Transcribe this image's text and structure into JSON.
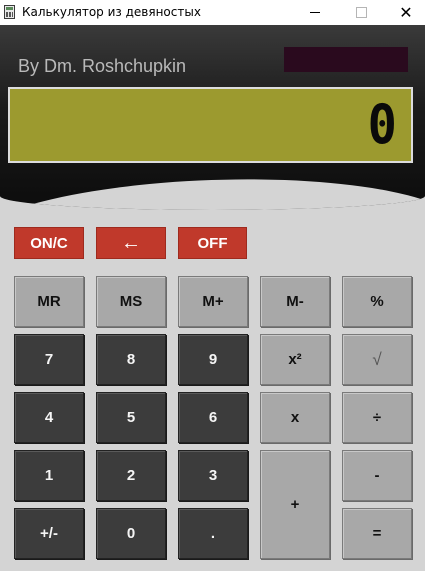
{
  "window": {
    "title": "Калькулятор из девяностых",
    "minimize": "",
    "maximize": "",
    "close": "✕"
  },
  "display": {
    "author": "By Dm. Roshchupkin",
    "value": "0"
  },
  "control_buttons": {
    "on_c": "ON/C",
    "backspace": "←",
    "off": "OFF"
  },
  "memory_buttons": {
    "mr": "MR",
    "ms": "MS",
    "m_plus": "M+",
    "m_minus": "M-",
    "percent": "%"
  },
  "keys": {
    "seven": "7",
    "eight": "8",
    "nine": "9",
    "four": "4",
    "five": "5",
    "six": "6",
    "one": "1",
    "two": "2",
    "three": "3",
    "sign": "+/-",
    "zero": "0",
    "dot": "."
  },
  "operators": {
    "square": "x²",
    "sqrt": "√",
    "multiply": "x",
    "divide": "÷",
    "plus": "+",
    "minus": "-",
    "equals": "="
  },
  "colors": {
    "lcd": "#9c9a2f",
    "red_button": "#c0392b",
    "dark_button": "#3c3c3c",
    "gray_button": "#a8a8a8",
    "memory_indicator": "#2a0a1e"
  }
}
